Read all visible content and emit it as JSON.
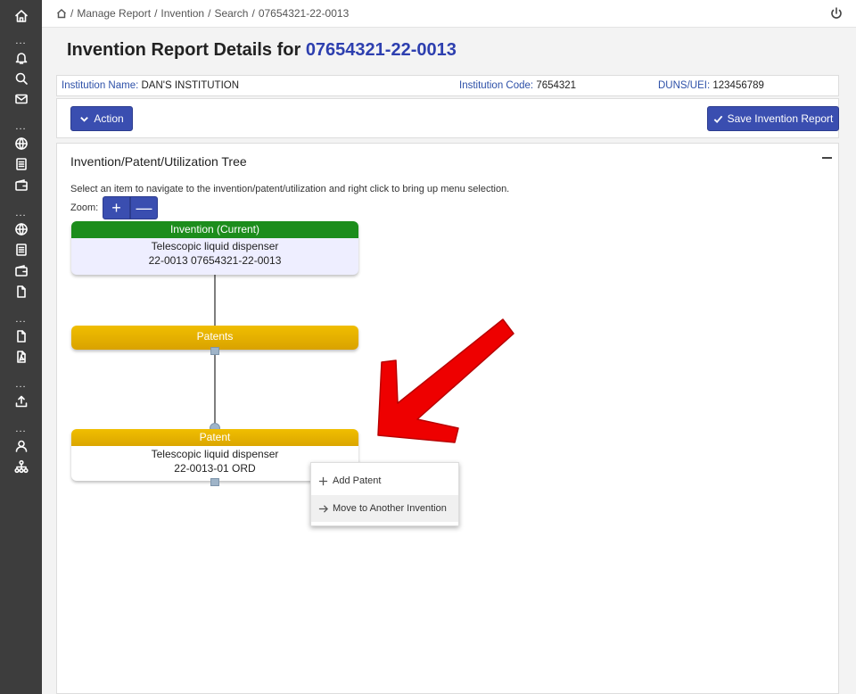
{
  "breadcrumb": {
    "items": [
      "Manage Report",
      "Invention",
      "Search",
      "07654321-22-0013"
    ]
  },
  "page": {
    "title_prefix": "Invention Report Details for",
    "report_id": "07654321-22-0013"
  },
  "institution": {
    "name_label": "Institution Name:",
    "name": "DAN'S INSTITUTION",
    "code_label": "Institution Code:",
    "code": "7654321",
    "duns_label": "DUNS/UEI:",
    "duns": "123456789"
  },
  "toolbar": {
    "action_label": "Action",
    "save_label": "Save Invention Report"
  },
  "tree_panel": {
    "title": "Invention/Patent/Utilization Tree",
    "instructions": "Select an item to navigate to the invention/patent/utilization and right click to bring up menu selection.",
    "zoom_label": "Zoom:",
    "zoom_in": "+",
    "zoom_out": "—"
  },
  "tree": {
    "invention": {
      "header": "Invention (Current)",
      "line1": "Telescopic liquid dispenser",
      "line2": "22-0013 07654321-22-0013"
    },
    "patents_group": {
      "header": "Patents"
    },
    "patent": {
      "header": "Patent",
      "line1": "Telescopic liquid dispenser",
      "line2": "22-0013-01 ORD"
    }
  },
  "context_menu": {
    "items": [
      {
        "label": "Add Patent",
        "icon": "plus-icon"
      },
      {
        "label": "Move to Another Invention",
        "icon": "arrow-right-icon"
      }
    ]
  },
  "colors": {
    "sidebar": "#3d3d3d",
    "accent": "#3a4eb0",
    "invention_header": "#1c8d1c",
    "patent_header": "#e4ad00",
    "annotation_arrow": "#ee0000"
  }
}
